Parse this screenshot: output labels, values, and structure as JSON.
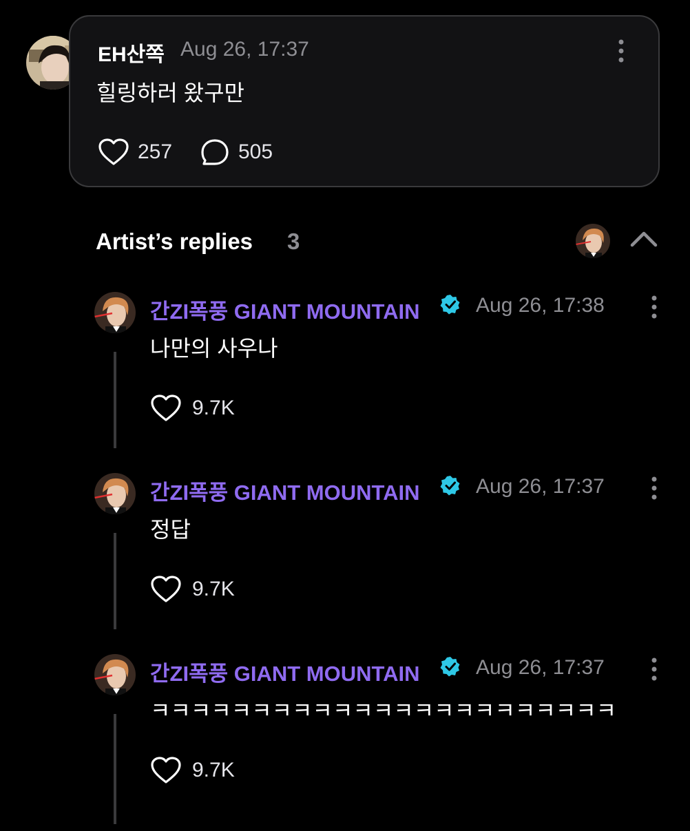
{
  "post": {
    "author": "EH산쪽",
    "time": "Aug 26, 17:37",
    "body": "힐링하러 왔구만",
    "likes": "257",
    "comments": "505"
  },
  "artist_replies": {
    "title": "Artist’s replies",
    "count": "3"
  },
  "replies": [
    {
      "author": "간ZI폭풍 GIANT MOUNTAIN",
      "time": "Aug 26, 17:38",
      "body": "나만의 사우나",
      "likes": "9.7K"
    },
    {
      "author": "간ZI폭풍 GIANT MOUNTAIN",
      "time": "Aug 26, 17:37",
      "body": "정답",
      "likes": "9.7K"
    },
    {
      "author": "간ZI폭풍 GIANT MOUNTAIN",
      "time": "Aug 26, 17:37",
      "body": "ㅋㅋㅋㅋㅋㅋㅋㅋㅋㅋㅋㅋㅋㅋㅋㅋㅋㅋㅋㅋㅋㅋㅋ",
      "likes": "9.7K"
    }
  ],
  "colors": {
    "background": "#000000",
    "card": "#121214",
    "card_border": "#3a3a3c",
    "artist_name": "#8f6bf0",
    "verified": "#2ec8e6",
    "muted": "#8e8e93"
  },
  "icons": {
    "like": "heart-outline-icon",
    "comment": "speech-bubble-icon",
    "more": "vertical-dots-icon",
    "verified": "verified-badge-icon",
    "collapse": "chevron-up-icon"
  }
}
